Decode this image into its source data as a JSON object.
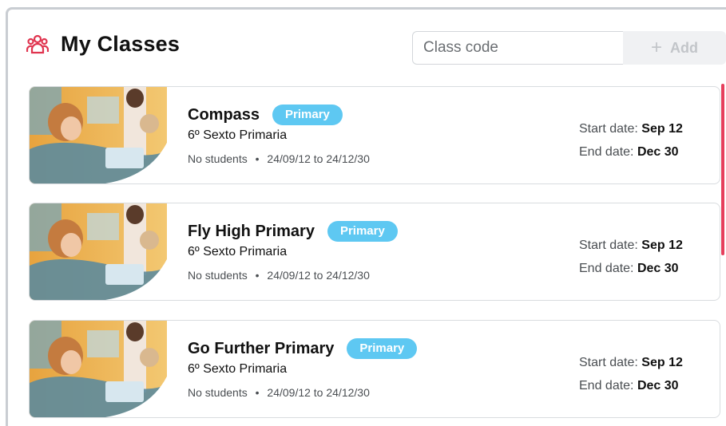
{
  "header": {
    "title": "My Classes",
    "icon": "people-group-icon",
    "accent_color": "#e0344f"
  },
  "join": {
    "placeholder": "Class code",
    "add_label": "Add",
    "add_icon": "plus-icon"
  },
  "classes": [
    {
      "title": "Compass",
      "badge": "Primary",
      "subtitle": "6º Sexto Primaria",
      "students": "No students",
      "separator": "•",
      "range": "24/09/12 to 24/12/30",
      "start_label": "Start date:",
      "start_value": "Sep 12",
      "end_label": "End date:",
      "end_value": "Dec 30"
    },
    {
      "title": "Fly High Primary",
      "badge": "Primary",
      "subtitle": "6º Sexto Primaria",
      "students": "No students",
      "separator": "•",
      "range": "24/09/12 to 24/12/30",
      "start_label": "Start date:",
      "start_value": "Sep 12",
      "end_label": "End date:",
      "end_value": "Dec 30"
    },
    {
      "title": "Go Further Primary",
      "badge": "Primary",
      "subtitle": "6º Sexto Primaria",
      "students": "No students",
      "separator": "•",
      "range": "24/09/12 to 24/12/30",
      "start_label": "Start date:",
      "start_value": "Sep 12",
      "end_label": "End date:",
      "end_value": "Dec 30"
    }
  ],
  "colors": {
    "badge": "#5ec8f2",
    "scrollbar": "#e63f5c"
  }
}
